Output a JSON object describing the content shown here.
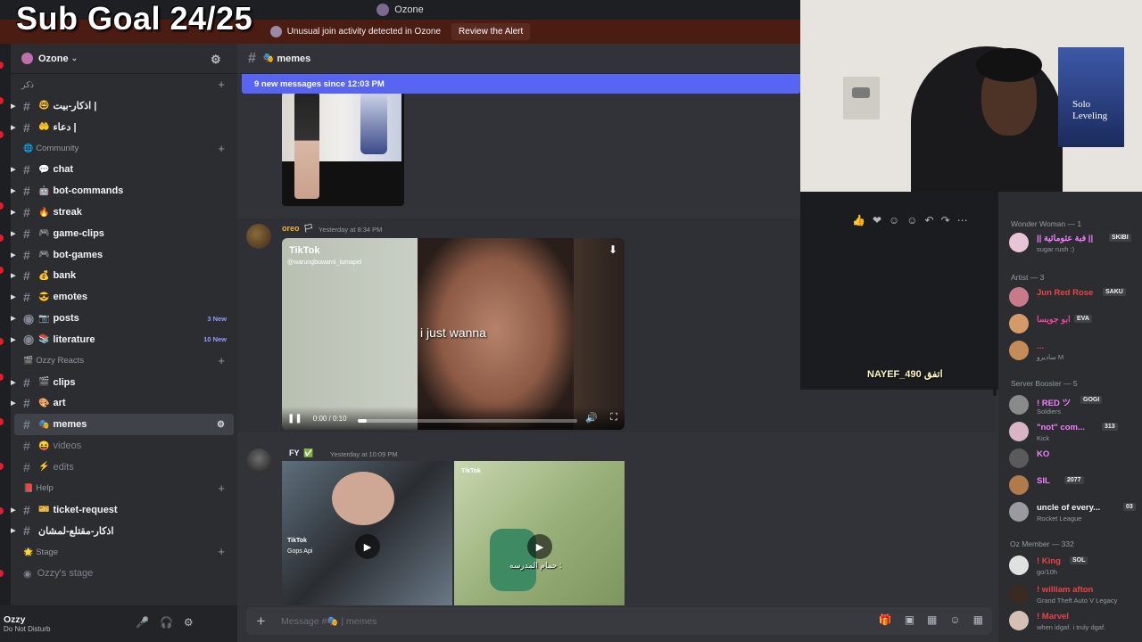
{
  "overlay": {
    "goal_text": "Sub Goal 24/25"
  },
  "window": {
    "title": "Ozone"
  },
  "alert": {
    "text": "Unusual join activity detected in Ozone",
    "button": "Review the Alert"
  },
  "server": {
    "name": "Ozone",
    "chevron": "⌄",
    "invite_icon": "add-member-icon"
  },
  "categories": {
    "c1": {
      "name": "ذكر"
    },
    "community": {
      "name": "Community"
    },
    "ozzy_reacts": {
      "name": "Ozzy Reacts"
    },
    "help": {
      "name": "Help"
    },
    "stage": {
      "name": "Stage"
    }
  },
  "channels": [
    {
      "emoji": "🤓",
      "name": "اذكار-بيت |"
    },
    {
      "emoji": "🤲",
      "name": "دعاء |"
    },
    {
      "emoji": "💬",
      "name": "chat"
    },
    {
      "emoji": "🤖",
      "name": "bot-commands"
    },
    {
      "emoji": "🔥",
      "name": "streak"
    },
    {
      "emoji": "🎮",
      "name": "game-clips"
    },
    {
      "emoji": "🎮",
      "name": "bot-games"
    },
    {
      "emoji": "💰",
      "name": "bank"
    },
    {
      "emoji": "😎",
      "name": "emotes"
    },
    {
      "emoji": "📷",
      "name": "posts",
      "badge": "3 New"
    },
    {
      "emoji": "📚",
      "name": "literature",
      "badge": "10 New"
    },
    {
      "emoji": "🎬",
      "name": "clips"
    },
    {
      "emoji": "🎨",
      "name": "art"
    },
    {
      "emoji": "🎭",
      "name": "memes"
    },
    {
      "emoji": "😝",
      "name": "videos"
    },
    {
      "emoji": "⚡",
      "name": "edits"
    },
    {
      "emoji": "🎫",
      "name": "ticket-request"
    },
    {
      "emoji": "",
      "name": "اذكار-مقتلع-لمشان"
    }
  ],
  "stage_channel": {
    "name": "Ozzy's stage"
  },
  "user": {
    "name": "Ozzy",
    "status": "Do Not Disturb"
  },
  "chat": {
    "channel_emoji": "🎭",
    "channel_name": "memes",
    "new_messages": "9 new messages since 12:03 PM",
    "messages": [
      {
        "author": "oreo",
        "badge": "🏳",
        "time": "Yesterday at 8:34 PM",
        "video": {
          "brand": "TikTok",
          "handle": "@warungbuwarni_tumapel",
          "caption": "i just wanna",
          "timecode": "0:00 / 0:10",
          "progress": 0.04
        }
      },
      {
        "author": "FY",
        "badge": "✅",
        "time": "Yesterday at 10:09 PM",
        "videos": [
          {
            "brand": "TikTok",
            "handle": "Gops Api"
          },
          {
            "brand": "TikTok",
            "caption": "حمام المدرسه :"
          }
        ]
      }
    ]
  },
  "composer": {
    "placeholder": "Message #🎭 | memes"
  },
  "stream_overlay": {
    "viewer_label": "NAYEF_490 اتفق"
  },
  "poster": {
    "text": "Solo Leveling"
  },
  "member_list": {
    "groups": [
      {
        "name": "Wonder Woman — 1"
      },
      {
        "name": "Artist — 3"
      },
      {
        "name": "Server Booster — 5"
      },
      {
        "name": "Oz Member — 332"
      }
    ],
    "members": [
      {
        "name": "|| فبة عثومائية ||",
        "tag": "SKIBI",
        "status": "sugar rush :)",
        "color": "#f47fff"
      },
      {
        "name": "Jun Red Rose",
        "tag": "SAKU",
        "status": "",
        "color": "#ed4245"
      },
      {
        "name": "ابو جويسا",
        "tag": "EVA",
        "status": "",
        "color": "#eb459e"
      },
      {
        "name": "...",
        "tag": "",
        "status": "ساديرو M",
        "color": "#ed4245"
      },
      {
        "name": "! RED ツ",
        "tag": "GOGI",
        "status": "Soldiers",
        "color": "#f47fff"
      },
      {
        "name": "\"not\" com...",
        "tag": "313",
        "status": "Kick",
        "color": "#f47fff"
      },
      {
        "name": "KO",
        "tag": "",
        "status": "",
        "color": "#f47fff"
      },
      {
        "name": "SIL",
        "tag": "2077",
        "status": "",
        "color": "#f47fff"
      },
      {
        "name": "uncle of every...",
        "tag": "03",
        "status": "Rocket League",
        "color": "#f2f3f5"
      },
      {
        "name": "! King",
        "tag": "SOL",
        "status": "go/10h",
        "color": "#ed4245"
      },
      {
        "name": "! william afton",
        "tag": "",
        "status": "Grand Theft Auto V Legacy",
        "color": "#ed4245"
      },
      {
        "name": "! Marvel",
        "tag": "",
        "status": "when idgaf. i truly dgaf.",
        "color": "#ed4245"
      }
    ]
  },
  "colors": {
    "accent": "#5865f2",
    "alert_bg": "#4a1c12",
    "sidebar": "#2b2d31",
    "chat": "#313338"
  }
}
